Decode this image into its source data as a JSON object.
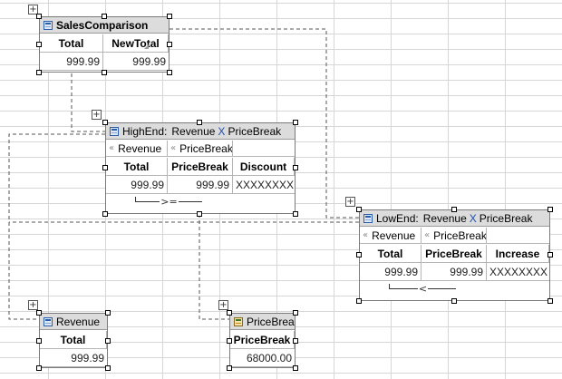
{
  "sales_comparison": {
    "title": "SalesComparison",
    "columns": [
      "Total",
      "NewTotal"
    ],
    "values": [
      "999.99",
      "999.99"
    ]
  },
  "highend": {
    "title_prefix": "HighEnd:",
    "title_left": "Revenue",
    "title_cross": "X",
    "title_right": "PriceBreak",
    "tabs": [
      "Revenue",
      "PriceBreak"
    ],
    "columns": [
      "Total",
      "PriceBreak",
      "Discount"
    ],
    "values": [
      "999.99",
      "999.99",
      "XXXXXXXX"
    ],
    "join_op": ">="
  },
  "lowend": {
    "title_prefix": "LowEnd:",
    "title_left": "Revenue",
    "title_cross": "X",
    "title_right": "PriceBreak",
    "tabs": [
      "Revenue",
      "PriceBreak"
    ],
    "columns": [
      "Total",
      "PriceBreak",
      "Increase"
    ],
    "values": [
      "999.99",
      "999.99",
      "XXXXXXXX"
    ],
    "join_op": "<"
  },
  "revenue": {
    "title": "Revenue",
    "column": "Total",
    "value": "999.99"
  },
  "pricebreak": {
    "title": "PriceBreak",
    "column": "PriceBreak",
    "value": "68000.00"
  },
  "icons": {
    "move": "move-handle-icon",
    "table": "table-icon",
    "image_table": "image-table-icon",
    "cross": "cross-join-icon",
    "tab_chevron": "double-chevron-left-icon"
  }
}
